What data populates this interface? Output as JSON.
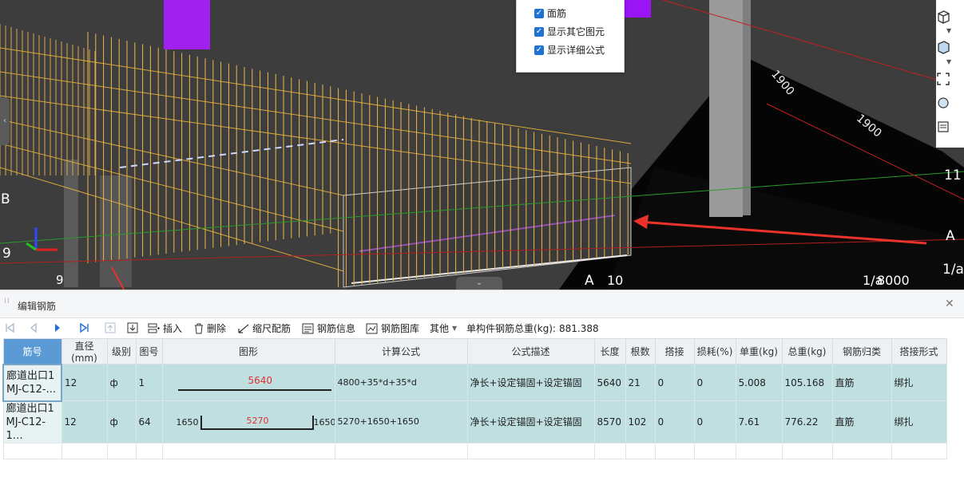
{
  "viewport": {
    "popup": {
      "items": [
        "面筋",
        "显示其它图元",
        "显示详细公式"
      ]
    },
    "axis_labels": {
      "left_b": "B",
      "left_9": "9",
      "bottom_9": "9",
      "bottom_a": "A",
      "bottom_10": "10",
      "right_a": "A",
      "right_1a": "1/a",
      "bottom_1a": "1/a",
      "bottom_8000": "8000",
      "right_11": "11"
    },
    "dim_labels": [
      "1900",
      "1900"
    ]
  },
  "panel": {
    "title": "编辑钢筋",
    "toolbar": {
      "insert": "插入",
      "delete": "删除",
      "scale": "缩尺配筋",
      "info": "钢筋信息",
      "library": "钢筋图库",
      "other": "其他",
      "total_label": "单构件钢筋总重(kg):",
      "total_value": "881.388"
    },
    "columns": [
      "筋号",
      "直径(mm)",
      "级别",
      "图号",
      "图形",
      "计算公式",
      "公式描述",
      "长度",
      "根数",
      "搭接",
      "损耗(%)",
      "单重(kg)",
      "总重(kg)",
      "钢筋归类",
      "搭接形式"
    ],
    "rows": [
      {
        "name": "廊道出口1\nMJ-C12-...",
        "diameter": "12",
        "grade": "ф",
        "figure_no": "1",
        "shape_main": "5640",
        "formula": "4800+35*d+35*d",
        "description": "净长+设定锚固+设定锚固",
        "length": "5640",
        "count": "21",
        "lap": "0",
        "loss": "0",
        "unit_weight": "5.008",
        "total_weight": "105.168",
        "category": "直筋",
        "lap_type": "绑扎"
      },
      {
        "name": "廊道出口1\nMJ-C12-1…",
        "diameter": "12",
        "grade": "ф",
        "figure_no": "64",
        "shape_left": "1650",
        "shape_main": "5270",
        "shape_right": "1650",
        "formula": "5270+1650+1650",
        "description": "净长+设定锚固+设定锚固",
        "length": "8570",
        "count": "102",
        "lap": "0",
        "loss": "0",
        "unit_weight": "7.61",
        "total_weight": "776.22",
        "category": "直筋",
        "lap_type": "绑扎"
      }
    ]
  },
  "colors": {
    "annotation": "#e8322a",
    "selected_header": "#5b9bd5",
    "row_bg": "#bfdfe1",
    "checkbox": "#1e72d6"
  }
}
